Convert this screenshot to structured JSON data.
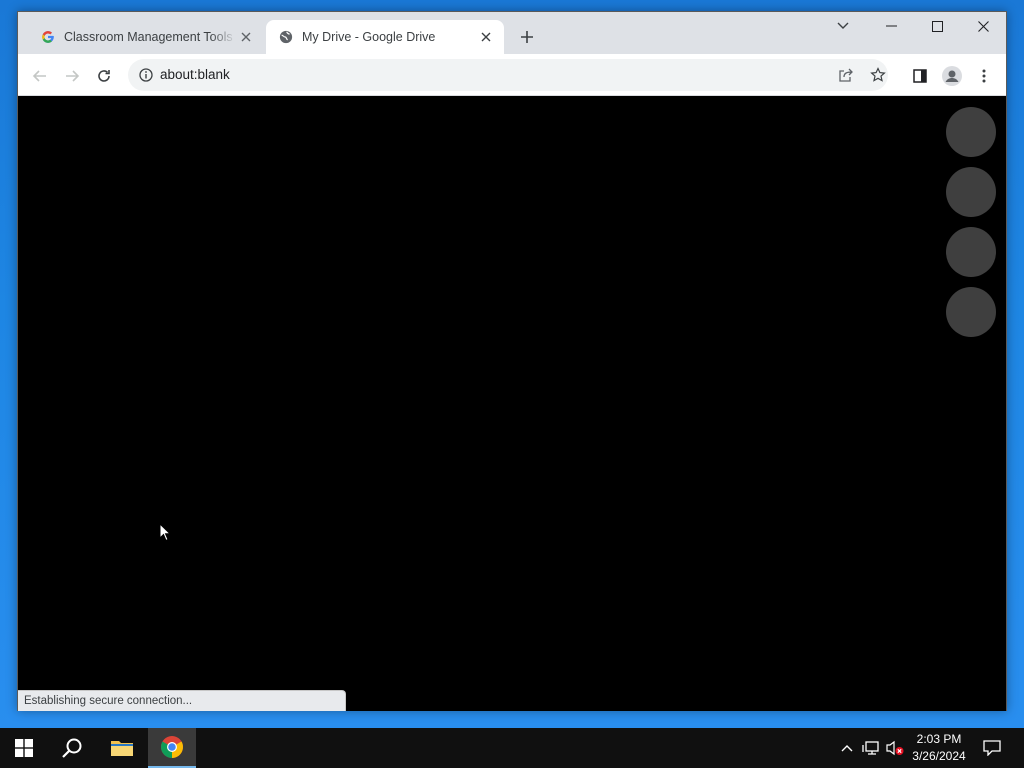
{
  "browser": {
    "tabs": [
      {
        "title": "Classroom Management Tools &",
        "favicon": "google-g-icon",
        "active": false
      },
      {
        "title": "My Drive - Google Drive",
        "favicon": "globe-icon",
        "active": true
      }
    ],
    "address": {
      "url": "about:blank"
    },
    "status_text": "Establishing secure connection..."
  },
  "taskbar": {
    "clock_time": "2:03 PM",
    "clock_date": "3/26/2024",
    "pinned": [
      "start-icon",
      "search-icon",
      "file-explorer-icon",
      "chrome-icon"
    ]
  },
  "colors": {
    "desktop": "#1e86e3",
    "tabstrip": "#dee1e6",
    "taskbar": "#101010",
    "viewport": "#000000"
  }
}
